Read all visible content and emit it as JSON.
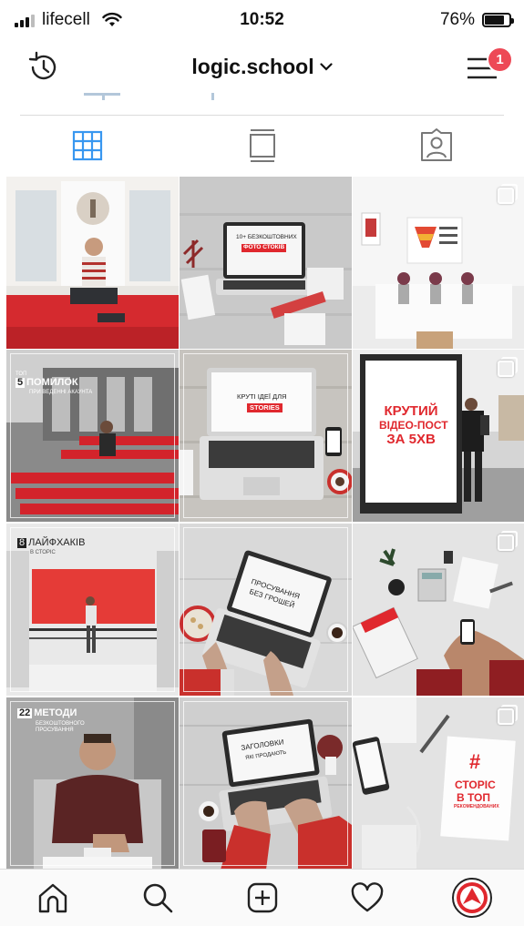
{
  "status_bar": {
    "carrier": "lifecell",
    "time": "10:52",
    "battery_percent": "76%",
    "battery_level": 0.76
  },
  "header": {
    "account_name": "logic.school",
    "notification_count": "1"
  },
  "tabs": [
    {
      "icon": "grid-icon",
      "active": true
    },
    {
      "icon": "feed-icon",
      "active": false
    },
    {
      "icon": "tagged-icon",
      "active": false
    }
  ],
  "posts": [
    {
      "id": "p1",
      "overlay": null
    },
    {
      "id": "p2",
      "laptop_line1": "10+ БЕЗКОШТОВНИХ",
      "laptop_line2": "ФОТО СТОКІВ"
    },
    {
      "id": "p3",
      "multi": true
    },
    {
      "id": "p4",
      "top": "ТОП",
      "num": "5",
      "title": "ПОМИЛОК",
      "sub": "ПРИ ВЕДЕННІ АКАУНТА"
    },
    {
      "id": "p5",
      "laptop_line1": "КРУТІ ІДЕЇ ДЛЯ",
      "laptop_line2": "STORIES"
    },
    {
      "id": "p6",
      "multi": true,
      "line1": "КРУТИЙ",
      "line2": "ВІДЕО-ПОСТ",
      "line3": "ЗА 5ХВ"
    },
    {
      "id": "p7",
      "num": "8",
      "title": "ЛАЙФХАКІВ",
      "sub": "В СТОРІС"
    },
    {
      "id": "p8",
      "laptop_line1": "ПРОСУВАННЯ",
      "laptop_line2": "БЕЗ ГРОШЕЙ"
    },
    {
      "id": "p9",
      "multi": true
    },
    {
      "id": "p10",
      "num": "22",
      "title": "МЕТОДИ",
      "sub1": "БЕЗКОШТОВНОГО",
      "sub2": "ПРОСУВАННЯ"
    },
    {
      "id": "p11",
      "laptop_line1": "ЗАГОЛОВКИ",
      "laptop_line2": "ЯКІ ПРОДАЮТЬ"
    },
    {
      "id": "p12",
      "multi": true,
      "hash": "#",
      "line1": "СТОРІС",
      "line2": "В ТОП",
      "line3": "РЕКОМЕНДОВАНИХ"
    }
  ],
  "tab_bar": [
    {
      "icon": "home-icon"
    },
    {
      "icon": "search-icon"
    },
    {
      "icon": "new-post-icon"
    },
    {
      "icon": "activity-heart-icon"
    },
    {
      "icon": "profile-avatar-icon"
    }
  ],
  "colors": {
    "accent_blue": "#3897f0",
    "badge_red": "#ed4956",
    "brand_red": "#e0282e"
  }
}
